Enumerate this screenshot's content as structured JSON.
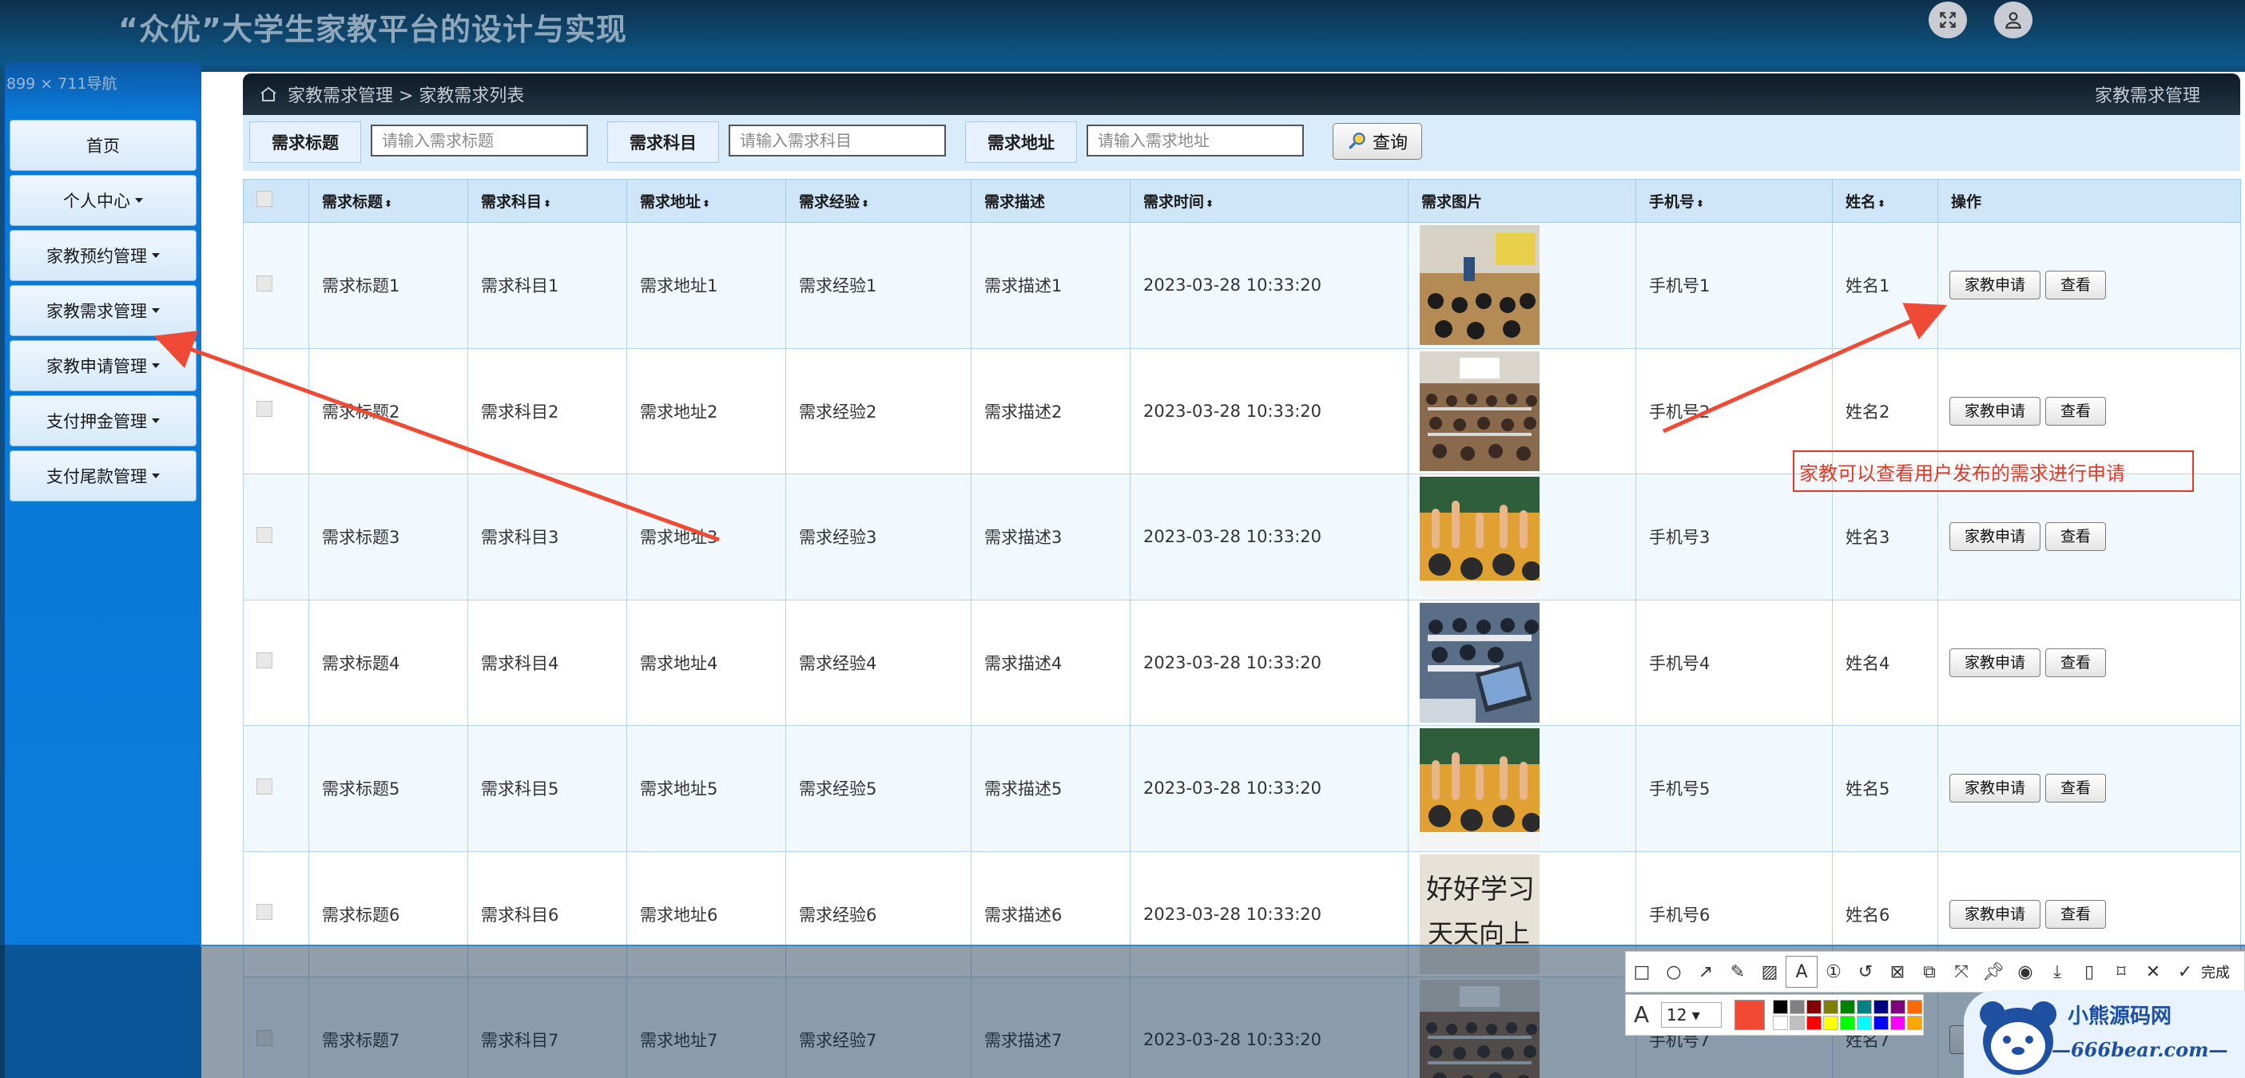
{
  "app": {
    "title": "“众优”大学生家教平台的设计与实现",
    "dimension_label": "899 × 711",
    "dimension_suffix": "导航"
  },
  "sidebar": {
    "items": [
      {
        "label": "首页",
        "has_caret": false
      },
      {
        "label": "个人中心",
        "has_caret": true
      },
      {
        "label": "家教预约管理",
        "has_caret": true
      },
      {
        "label": "家教需求管理",
        "has_caret": true
      },
      {
        "label": "家教申请管理",
        "has_caret": true
      },
      {
        "label": "支付押金管理",
        "has_caret": true
      },
      {
        "label": "支付尾款管理",
        "has_caret": true
      }
    ]
  },
  "breadcrumb": {
    "path": "家教需求管理 > 家教需求列表",
    "right": "家教需求管理"
  },
  "search": {
    "title_label": "需求标题",
    "title_placeholder": "请输入需求标题",
    "subject_label": "需求科目",
    "subject_placeholder": "请输入需求科目",
    "address_label": "需求地址",
    "address_placeholder": "请输入需求地址",
    "query_button": "查询"
  },
  "table": {
    "headers": [
      "需求标题",
      "需求科目",
      "需求地址",
      "需求经验",
      "需求描述",
      "需求时间",
      "需求图片",
      "手机号",
      "姓名",
      "操作"
    ],
    "sortable": [
      true,
      true,
      true,
      true,
      false,
      true,
      false,
      true,
      true,
      false
    ],
    "rows": [
      {
        "title": "需求标题1",
        "subject": "需求科目1",
        "address": "需求地址1",
        "experience": "需求经验1",
        "desc": "需求描述1",
        "time": "2023-03-28 10:33:20",
        "image": "classroom-lecture",
        "phone": "手机号1",
        "name": "姓名1"
      },
      {
        "title": "需求标题2",
        "subject": "需求科目2",
        "address": "需求地址2",
        "experience": "需求经验2",
        "desc": "需求描述2",
        "time": "2023-03-28 10:33:20",
        "image": "lecture-hall",
        "phone": "手机号2",
        "name": "姓名2"
      },
      {
        "title": "需求标题3",
        "subject": "需求科目3",
        "address": "需求地址3",
        "experience": "需求经验3",
        "desc": "需求描述3",
        "time": "2023-03-28 10:33:20",
        "image": "raised-hands",
        "phone": "手机号3",
        "name": "姓名3"
      },
      {
        "title": "需求标题4",
        "subject": "需求科目4",
        "address": "需求地址4",
        "experience": "需求经验4",
        "desc": "需求描述4",
        "time": "2023-03-28 10:33:20",
        "image": "computer-class",
        "phone": "手机号4",
        "name": "姓名4"
      },
      {
        "title": "需求标题5",
        "subject": "需求科目5",
        "address": "需求地址5",
        "experience": "需求经验5",
        "desc": "需求描述5",
        "time": "2023-03-28 10:33:20",
        "image": "raised-hands",
        "phone": "手机号5",
        "name": "姓名5"
      },
      {
        "title": "需求标题6",
        "subject": "需求科目6",
        "address": "需求地址6",
        "experience": "需求经验6",
        "desc": "需求描述6",
        "time": "2023-03-28 10:33:20",
        "image": "handwriting",
        "phone": "手机号6",
        "name": "姓名6"
      },
      {
        "title": "需求标题7",
        "subject": "需求科目7",
        "address": "需求地址7",
        "experience": "需求经验7",
        "desc": "需求描述7",
        "time": "2023-03-28 10:33:20",
        "image": "lecture-hall",
        "phone": "手机号7",
        "name": "姓名7"
      }
    ],
    "apply_button": "家教申请",
    "view_button": "查看"
  },
  "annotation": {
    "text": "家教可以查看用户发布的需求进行申请",
    "color": "#e23a2a"
  },
  "screenshot_tool": {
    "font_size": "12",
    "current_color": "#f04a35",
    "done_label": "完成",
    "palette": [
      "#000000",
      "#808080",
      "#800000",
      "#808000",
      "#008000",
      "#008080",
      "#000080",
      "#800080",
      "#ff6a00",
      "#ffffff",
      "#c0c0c0",
      "#ff0000",
      "#ffff00",
      "#00ff00",
      "#00ffff",
      "#0000ff",
      "#ff00ff",
      "#ffa500"
    ]
  },
  "watermark": {
    "title": "小熊源码网",
    "url": "—666bear.com—"
  },
  "colors": {
    "sidebar": "#0b7ddc",
    "header": "#0c5a8c",
    "table_header": "#cfe6f8"
  }
}
